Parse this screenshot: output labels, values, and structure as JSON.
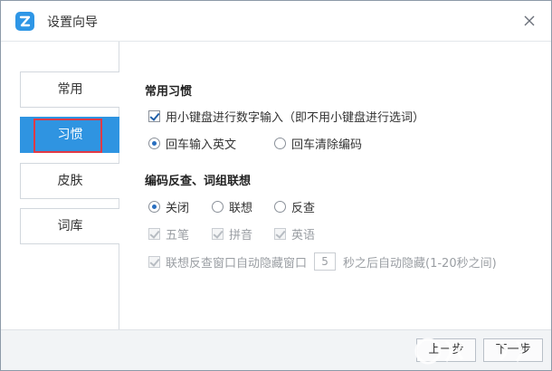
{
  "window": {
    "title": "设置向导",
    "logo_icon": "app-logo-icon",
    "accent": "#2f94e1"
  },
  "sidebar": {
    "items": [
      {
        "label": "常用"
      },
      {
        "label": "习惯",
        "active": true
      },
      {
        "label": "皮肤"
      },
      {
        "label": "词库"
      }
    ],
    "highlight_color": "#e23a46"
  },
  "habits": {
    "title": "常用习惯",
    "numpad_option": "用小键盘进行数字输入（即不用小键盘进行选词）",
    "enter_options": [
      "回车输入英文",
      "回车清除编码"
    ]
  },
  "lookup": {
    "title": "编码反查、词组联想",
    "modes": [
      "关闭",
      "联想",
      "反查"
    ],
    "sources": [
      "五笔",
      "拼音",
      "英语"
    ],
    "autohide_prefix": "联想反查窗口自动隐藏窗口",
    "autohide_seconds": "5",
    "autohide_suffix": "秒之后自动隐藏(1-20秒之间)"
  },
  "footer": {
    "prev_label": "上一步",
    "next_label": "下一步"
  }
}
